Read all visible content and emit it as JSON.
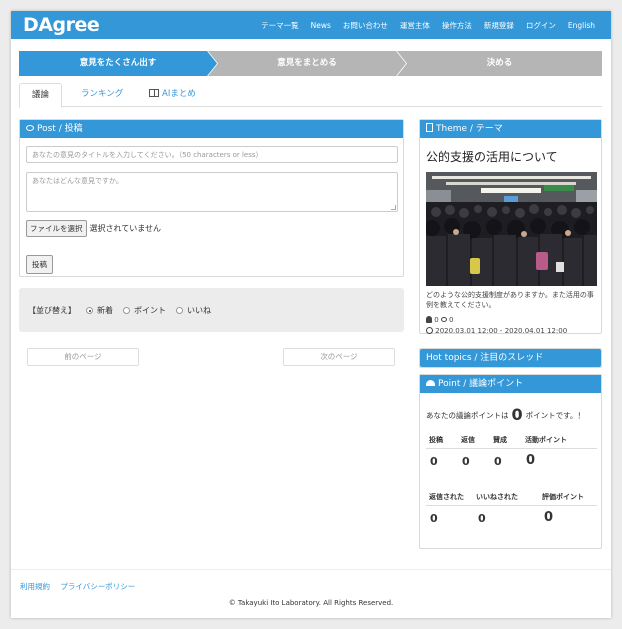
{
  "header": {
    "logo": "DAgree",
    "nav": [
      "テーマ一覧",
      "News",
      "お問い合わせ",
      "運営主体",
      "操作方法",
      "新規登録",
      "ログイン",
      "English"
    ]
  },
  "steps": [
    "意見をたくさん出す",
    "意見をまとめる",
    "決める"
  ],
  "tabs": [
    "議論",
    "ランキング",
    "AIまとめ"
  ],
  "post": {
    "heading": "Post / 投稿",
    "title_placeholder": "あなたの意見のタイトルを入力してください。（50 characters or less）",
    "body_placeholder": "あなたはどんな意見ですか。",
    "file_button": "ファイルを選択",
    "file_status": "選択されていません",
    "submit": "投稿"
  },
  "sort": {
    "label": "【並び替え】",
    "options": [
      "新着",
      "ポイント",
      "いいね"
    ],
    "selected": "新着"
  },
  "pager": {
    "prev": "前のページ",
    "next": "次のページ"
  },
  "theme": {
    "heading": "Theme / テーマ",
    "title": "公的支援の活用について",
    "description": "どのような公的支援制度がありますか。また活用の事例を教えてください。",
    "likes": "0",
    "comments": "0",
    "period": "2020.03.01 12:00 - 2020.04.01 12:00"
  },
  "hot_topics": {
    "heading": "Hot topics / 注目のスレッド"
  },
  "points": {
    "heading": "Point / 議論ポイント",
    "line_prefix": "あなたの議論ポイントは",
    "total": "0",
    "line_suffix": "ポイントです。！",
    "table1": {
      "headers": [
        "投稿",
        "返信",
        "賛成",
        "活動ポイント"
      ],
      "values": [
        "0",
        "0",
        "0",
        "0"
      ]
    },
    "table2": {
      "headers": [
        "返信された",
        "いいねされた",
        "評価ポイント"
      ],
      "values": [
        "0",
        "0",
        "0"
      ]
    }
  },
  "footer": {
    "links": [
      "利用規約",
      "プライバシーポリシー"
    ],
    "copyright": "© Takayuki Ito Laboratory. All Rights Reserved."
  },
  "colors": {
    "primary": "#3397d8",
    "inactive_step": "#b5b5b5",
    "sort_bg": "#ececec"
  }
}
